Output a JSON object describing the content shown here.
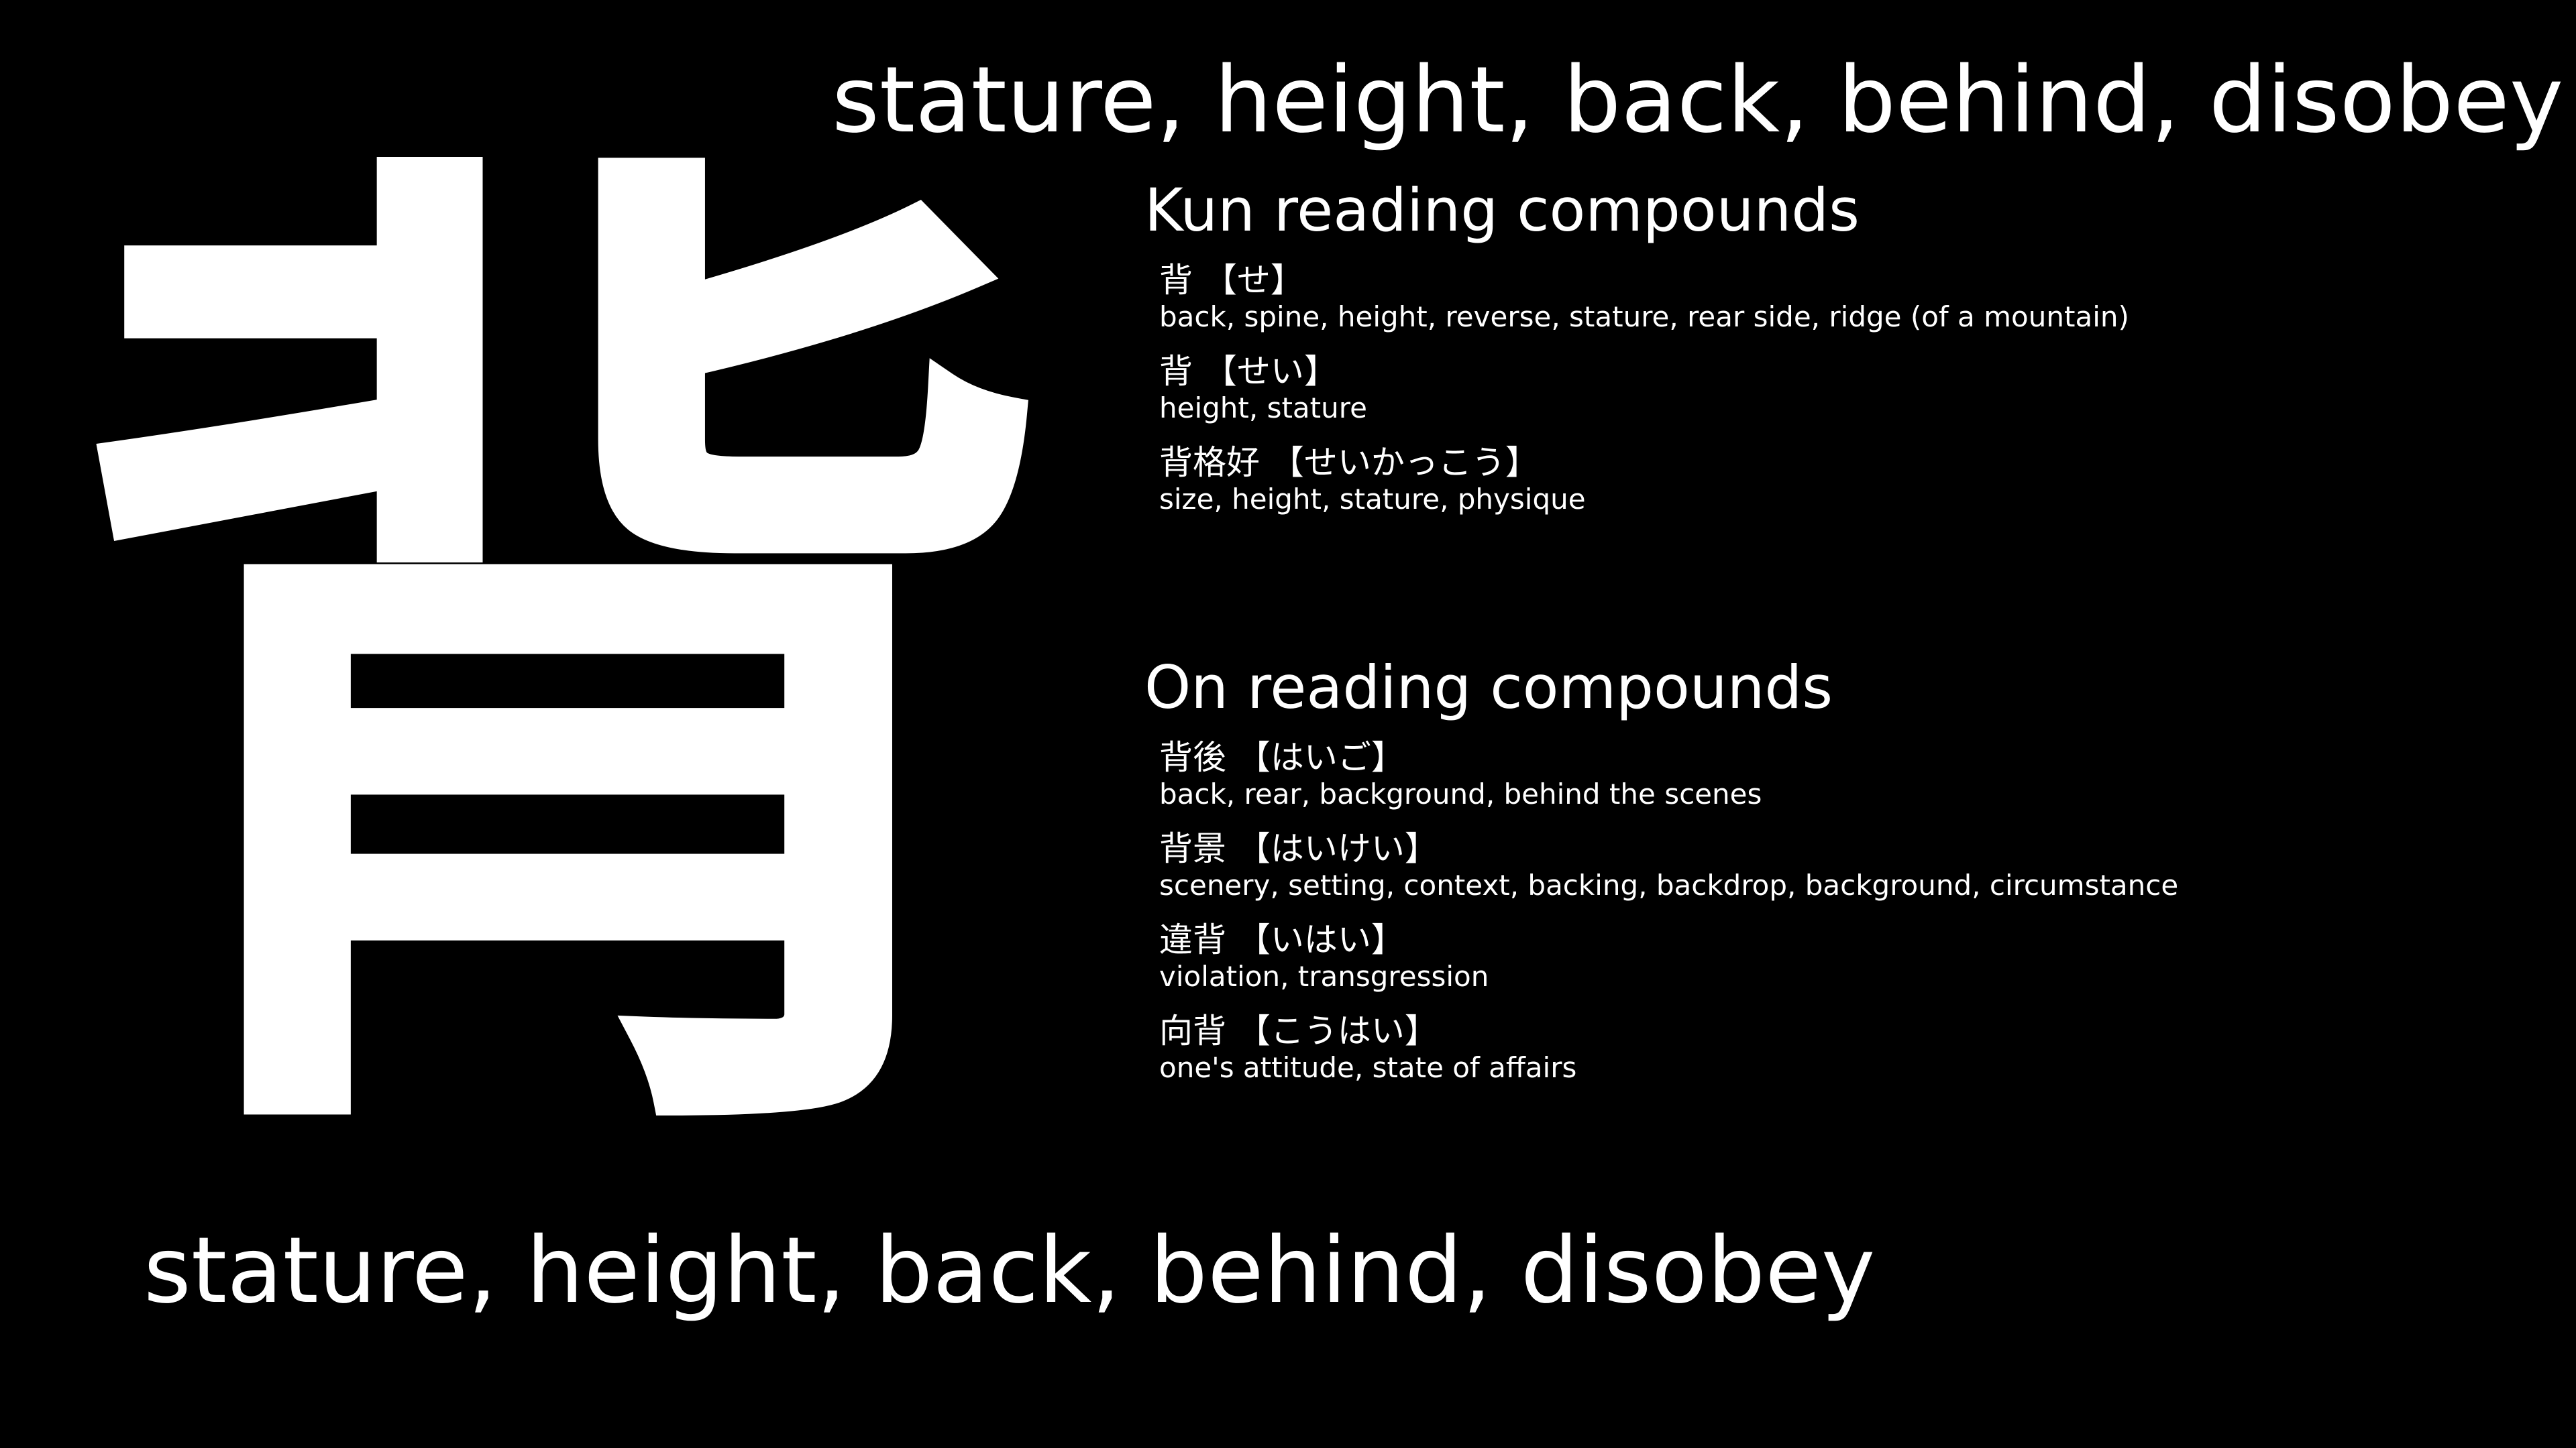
{
  "kanji": "背",
  "meaning": "stature, height, back, behind, disobey",
  "kun": {
    "title": "Kun reading compounds",
    "entries": [
      {
        "word": "背",
        "reading": "【せ】",
        "gloss": "back, spine, height, reverse, stature, rear side, ridge (of a mountain)"
      },
      {
        "word": "背",
        "reading": "【せい】",
        "gloss": "height, stature"
      },
      {
        "word": "背格好",
        "reading": "【せいかっこう】",
        "gloss": "size, height, stature, physique"
      }
    ]
  },
  "on": {
    "title": "On reading compounds",
    "entries": [
      {
        "word": "背後",
        "reading": "【はいご】",
        "gloss": "back, rear, background, behind the scenes"
      },
      {
        "word": "背景",
        "reading": "【はいけい】",
        "gloss": "scenery, setting, context, backing, backdrop, background, circumstance"
      },
      {
        "word": "違背",
        "reading": "【いはい】",
        "gloss": "violation, transgression"
      },
      {
        "word": "向背",
        "reading": "【こうはい】",
        "gloss": "one's attitude, state of affairs"
      }
    ]
  }
}
